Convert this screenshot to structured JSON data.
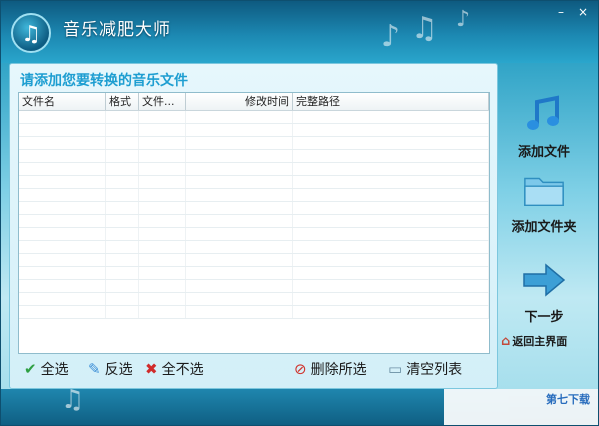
{
  "app": {
    "title": "音乐减肥大师",
    "minimize": "–",
    "close": "×"
  },
  "main": {
    "section_title": "请添加您要转换的音乐文件",
    "columns": [
      "文件名",
      "格式",
      "文件...",
      "修改时间",
      "完整路径"
    ],
    "row_count": 16
  },
  "bottom_actions": {
    "select_all": "全选",
    "invert": "反选",
    "select_none": "全不选",
    "delete_selected": "删除所选",
    "clear_list": "清空列表"
  },
  "side_buttons": {
    "add_file": "添加文件",
    "add_folder": "添加文件夹",
    "next": "下一步",
    "back_home": "返回主界面"
  },
  "watermark": "第七下载",
  "icons": {
    "logo": "music-note-icon",
    "add_file": "music-note-icon",
    "add_folder": "folder-icon",
    "next": "arrow-right-icon",
    "home": "house-icon",
    "select_all": "checkmark-icon",
    "invert": "pencil-icon",
    "select_none": "x-mark-icon",
    "delete": "delete-icon",
    "clear": "document-icon"
  },
  "colors": {
    "accent": "#1e9ed1",
    "titlebar": "#1c88b2"
  }
}
